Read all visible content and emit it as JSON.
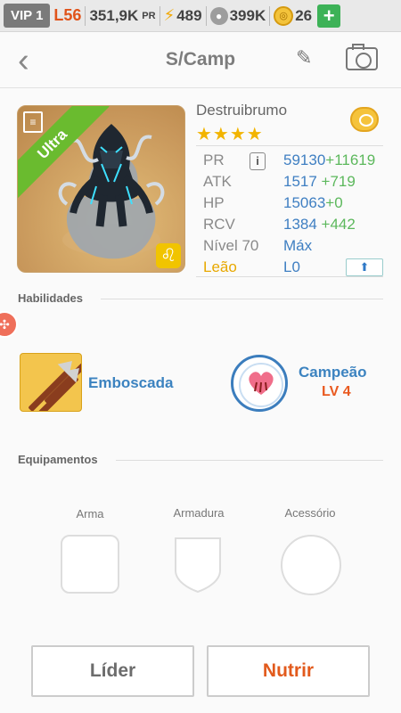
{
  "statusbar": {
    "vip": "VIP 1",
    "level": "L56",
    "power": "351,9K",
    "power_unit": "PR",
    "energy": "489",
    "paws": "399K",
    "coins": "26"
  },
  "header": {
    "title": "S/Camp"
  },
  "monster": {
    "rarity": "Ultra",
    "name": "Destruibrumo",
    "stars": "★★★★",
    "stats": [
      {
        "label": "PR",
        "value": "59130",
        "bonus": "+11619"
      },
      {
        "label": "ATK",
        "value": "1517",
        "bonus": " +719"
      },
      {
        "label": "HP",
        "value": "15063",
        "bonus": "+0"
      },
      {
        "label": "RCV",
        "value": "1384",
        "bonus": " +442"
      }
    ],
    "level_label": "Nível 70",
    "level_value": "Máx",
    "sign_label": "Leão",
    "sign_value": "L0"
  },
  "abilities": {
    "title": "Habilidades",
    "skill1": "Emboscada",
    "skill2": "Campeão",
    "skill2_level": "LV 4"
  },
  "equipment": {
    "title": "Equipamentos",
    "slots": [
      "Arma",
      "Armadura",
      "Acessório"
    ]
  },
  "buttons": {
    "leader": "Líder",
    "nourish": "Nutrir"
  },
  "colors": {
    "accent_blue": "#3c83c0",
    "accent_orange": "#e25a1c",
    "bonus_green": "#5cb85c",
    "ultra_green": "#6abb2f"
  }
}
